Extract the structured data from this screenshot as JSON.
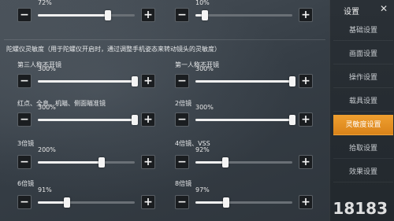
{
  "top_sliders": [
    {
      "value": "72%",
      "fraction": 0.72
    },
    {
      "value": "10%",
      "fraction": 0.1
    }
  ],
  "section": {
    "title": "陀螺仪灵敏度（用于陀螺仪开启时，通过调整手机姿态来转动镜头的灵敏度）"
  },
  "sliders": [
    {
      "label": "第三人称不开镜",
      "value": "300%",
      "fraction": 1.0
    },
    {
      "label": "第一人称不开镜",
      "value": "300%",
      "fraction": 1.0
    },
    {
      "label": "红点、全息、机瞄、侧面瞄准镜",
      "value": "300%",
      "fraction": 1.0
    },
    {
      "label": "2倍镜",
      "value": "300%",
      "fraction": 1.0
    },
    {
      "label": "3倍镜",
      "value": "200%",
      "fraction": 0.66
    },
    {
      "label": "4倍镜、VSS",
      "value": "92%",
      "fraction": 0.31
    },
    {
      "label": "6倍镜",
      "value": "91%",
      "fraction": 0.3
    },
    {
      "label": "8倍镜",
      "value": "97%",
      "fraction": 0.32
    }
  ],
  "buttons": {
    "minus": "−",
    "plus": "+"
  },
  "sidebar": {
    "title": "设置",
    "close": "✕",
    "items": [
      {
        "label": "基础设置"
      },
      {
        "label": "画面设置"
      },
      {
        "label": "操作设置"
      },
      {
        "label": "载具设置"
      },
      {
        "label": "灵敏度设置"
      },
      {
        "label": "拾取设置"
      },
      {
        "label": "效果设置"
      }
    ],
    "active_index": 4
  },
  "watermark": "18183",
  "colors": {
    "accent": "#e89426"
  }
}
